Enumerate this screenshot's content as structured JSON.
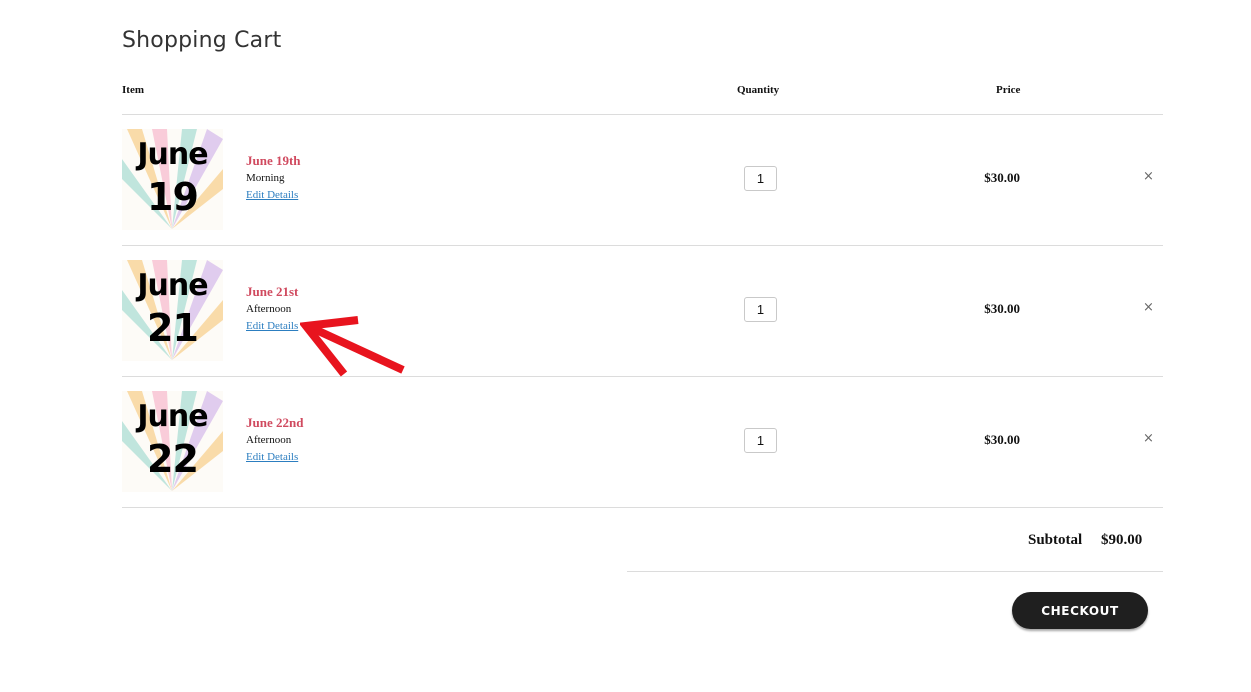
{
  "page": {
    "title": "Shopping Cart"
  },
  "columns": {
    "item": "Item",
    "quantity": "Quantity",
    "price": "Price"
  },
  "items": [
    {
      "name": "June 19th",
      "option": "Morning",
      "edit_label": "Edit Details",
      "quantity": "1",
      "price": "$30.00",
      "remove": "×",
      "thumb_line1": "June",
      "thumb_line2": "19"
    },
    {
      "name": "June 21st",
      "option": "Afternoon",
      "edit_label": "Edit Details",
      "quantity": "1",
      "price": "$30.00",
      "remove": "×",
      "thumb_line1": "June",
      "thumb_line2": "21"
    },
    {
      "name": "June 22nd",
      "option": "Afternoon",
      "edit_label": "Edit Details",
      "quantity": "1",
      "price": "$30.00",
      "remove": "×",
      "thumb_line1": "June",
      "thumb_line2": "22"
    }
  ],
  "summary": {
    "subtotal_label": "Subtotal",
    "subtotal_value": "$90.00"
  },
  "actions": {
    "checkout_label": "CHECKOUT"
  },
  "colors": {
    "product_name": "#d04a5f",
    "link": "#2c7ec0",
    "checkout_bg": "#1f1f1f",
    "annotation_arrow": "#e8141e"
  }
}
